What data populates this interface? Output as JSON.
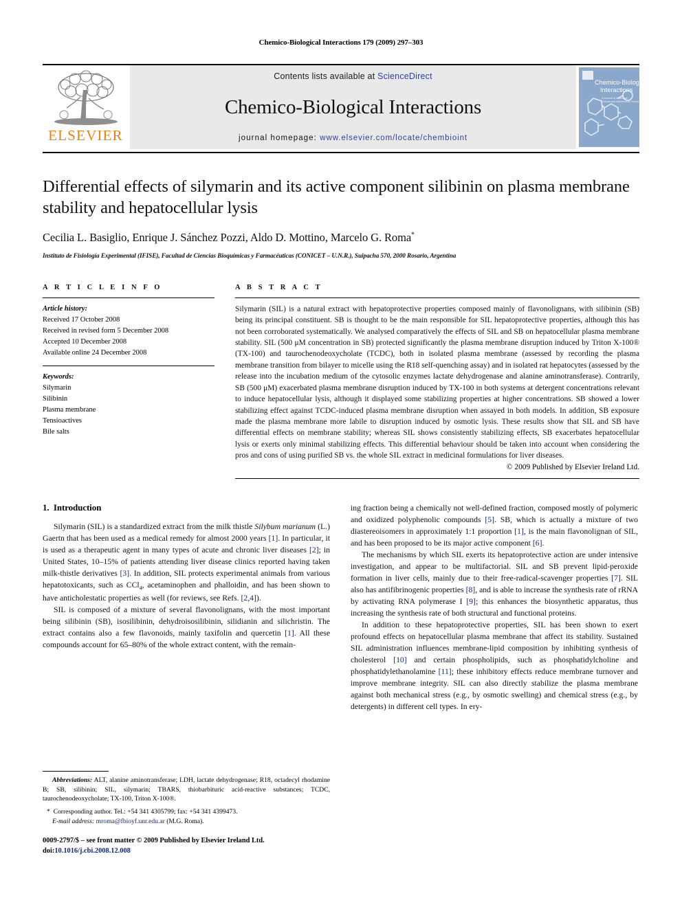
{
  "running_head": "Chemico-Biological Interactions 179 (2009) 297–303",
  "masthead": {
    "publisher_name": "ELSEVIER",
    "contents_prefix": "Contents lists available at ",
    "contents_link": "ScienceDirect",
    "journal_title": "Chemico-Biological Interactions",
    "homepage_label": "journal homepage:",
    "homepage_url": "www.elsevier.com/locate/chembioint",
    "cover_title_line1": "Chemico-Biological",
    "cover_title_line2": "Interactions",
    "cover_sub1": "A Journal of Molecular,",
    "cover_sub2": "Cellular and Biochemical Toxicology",
    "link_color": "#2f3f9e",
    "elsevier_orange": "#F07F13"
  },
  "article": {
    "title": "Differential effects of silymarin and its active component silibinin on plasma membrane stability and hepatocellular lysis",
    "authors": "Cecilia L. Basiglio, Enrique J. Sánchez Pozzi, Aldo D. Mottino, Marcelo G. Roma",
    "corresponding_marker": "*",
    "affiliation": "Instituto de Fisiología Experimental (IFISE), Facultad de Ciencias Bioquímicas y Farmacéuticas (CONICET – U.N.R.), Suipacha 570, 2000 Rosario, Argentina"
  },
  "article_info": {
    "heading": "A R T I C L E   I N F O",
    "history_label": "Article history:",
    "history": [
      "Received 17 October 2008",
      "Received in revised form 5 December 2008",
      "Accepted 10 December 2008",
      "Available online 24 December 2008"
    ],
    "keywords_label": "Keywords:",
    "keywords": [
      "Silymarin",
      "Silibinin",
      "Plasma membrane",
      "Tensioactives",
      "Bile salts"
    ]
  },
  "abstract": {
    "heading": "A B S T R A C T",
    "text": "Silymarin (SIL) is a natural extract with hepatoprotective properties composed mainly of flavonolignans, with silibinin (SB) being its principal constituent. SB is thought to be the main responsible for SIL hepatoprotective properties, although this has not been corroborated systematically. We analysed comparatively the effects of SIL and SB on hepatocellular plasma membrane stability. SIL (500 μM concentration in SB) protected significantly the plasma membrane disruption induced by Triton X-100® (TX-100) and taurochenodeoxycholate (TCDC), both in isolated plasma membrane (assessed by recording the plasma membrane transition from bilayer to micelle using the R18 self-quenching assay) and in isolated rat hepatocytes (assessed by the release into the incubation medium of the cytosolic enzymes lactate dehydrogenase and alanine aminotransferase). Contrarily, SB (500 μM) exacerbated plasma membrane disruption induced by TX-100 in both systems at detergent concentrations relevant to induce hepatocellular lysis, although it displayed some stabilizing properties at higher concentrations. SB showed a lower stabilizing effect against TCDC-induced plasma membrane disruption when assayed in both models. In addition, SB exposure made the plasma membrane more labile to disruption induced by osmotic lysis. These results show that SIL and SB have differential effects on membrane stability; whereas SIL shows consistently stabilizing effects, SB exacerbates hepatocellular lysis or exerts only minimal stabilizing effects. This differential behaviour should be taken into account when considering the pros and cons of using purified SB vs. the whole SIL extract in medicinal formulations for liver diseases.",
    "copyright": "© 2009 Published by Elsevier Ireland Ltd."
  },
  "introduction": {
    "section_number": "1.",
    "section_title": "Introduction",
    "paragraphs_left": [
      "Silymarin (SIL) is a standardized extract from the milk thistle Silybum marianum (L.) Gaertn that has been used as a medical remedy for almost 2000 years [1]. In particular, it is used as a therapeutic agent in many types of acute and chronic liver diseases [2]; in United States, 10–15% of patients attending liver disease clinics reported having taken milk-thistle derivatives [3]. In addition, SIL protects experimental animals from various hepatotoxicants, such as CCl4, acetaminophen and phalloidin, and has been shown to have anticholestatic properties as well (for reviews, see Refs. [2,4]).",
      "SIL is composed of a mixture of several flavonolignans, with the most important being silibinin (SB), isosilibinin, dehydroisosilibinin, silidianin and silichristin. The extract contains also a few flavonoids, mainly taxifolin and quercetin [1]. All these compounds account for 65–80% of the whole extract content, with the remain-"
    ],
    "paragraphs_right": [
      "ing fraction being a chemically not well-defined fraction, composed mostly of polymeric and oxidized polyphenolic compounds [5]. SB, which is actually a mixture of two diastereoisomers in approximately 1:1 proportion [1], is the main flavonolignan of SIL, and has been proposed to be its major active component [6].",
      "The mechanisms by which SIL exerts its hepatoprotective action are under intensive investigation, and appear to be multifactorial. SIL and SB prevent lipid-peroxide formation in liver cells, mainly due to their free-radical-scavenger properties [7]. SIL also has antifibrinogenic properties [8], and is able to increase the synthesis rate of rRNA by activating RNA polymerase I [9]; this enhances the biosynthetic apparatus, thus increasing the synthesis rate of both structural and functional proteins.",
      "In addition to these hepatoprotective properties, SIL has been shown to exert profound effects on hepatocellular plasma membrane that affect its stability. Sustained SIL administration influences membrane-lipid composition by inhibiting synthesis of cholesterol [10] and certain phospholipids, such as phosphatidylcholine and phosphatidylethanolamine [11]; these inhibitory effects reduce membrane turnover and improve membrane integrity. SIL can also directly stabilize the plasma membrane against both mechanical stress (e.g., by osmotic swelling) and chemical stress (e.g., by detergents) in different cell types. In ery-"
    ]
  },
  "footnotes": {
    "abbreviations_label": "Abbreviations:",
    "abbreviations_text": " ALT, alanine aminotransferase; LDH, lactate dehydrogenase; R18, octadecyl rhodamine B; SB, silibinin; SIL, silymarin; TBARS, thiobarbituric acid-reactive substances; TCDC, taurochenodeoxycholate; TX-100, Triton X-100®.",
    "corresponding_marker": "*",
    "corresponding_text": "Corresponding author. Tel.: +54 341 4305799; fax: +54 341 4399473.",
    "email_label": "E-mail address:",
    "email": "mroma@fbioyf.unr.edu.ar",
    "email_owner": "(M.G. Roma)."
  },
  "imprint": {
    "issn_line": "0009-2797/$ – see front matter © 2009 Published by Elsevier Ireland Ltd.",
    "doi_label": "doi:",
    "doi": "10.1016/j.cbi.2008.12.008"
  }
}
